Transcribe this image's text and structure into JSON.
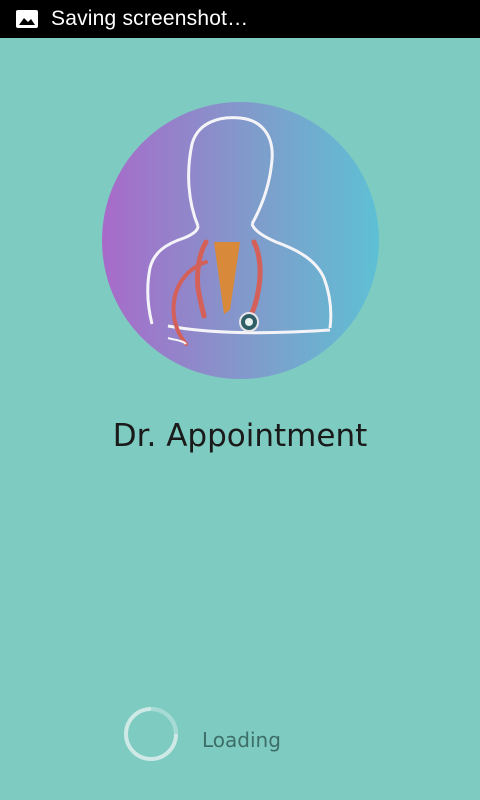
{
  "status_bar": {
    "notification_icon": "image-icon",
    "text": "Saving screenshot…"
  },
  "app": {
    "logo_icon": "doctor-stethoscope-icon",
    "title": "Dr. Appointment"
  },
  "loading": {
    "spinner_icon": "progress-spinner-icon",
    "text": "Loading"
  },
  "colors": {
    "background": "#7ecbc1",
    "status_bar": "#000000",
    "logo_gradient_left": "#a86ac9",
    "logo_gradient_right": "#5ec0d4",
    "stethoscope": "#d4605a",
    "tie": "#d8893a"
  }
}
